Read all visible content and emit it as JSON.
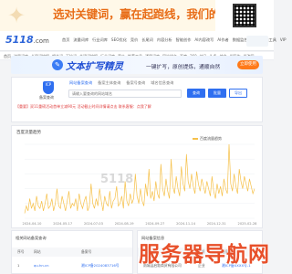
{
  "top_banner": {
    "headline": "选对关键词，赢在起跑线，我们的工具助你轻松实现!"
  },
  "header": {
    "logo": "5118",
    "logo_domain": ".com",
    "nav": [
      "首页",
      "流量词库",
      "行业词库",
      "SEO优化",
      "竞价",
      "长尾词",
      "内容分析",
      "智能创作",
      "AI内容改写",
      "AI作者",
      "数据监控",
      "API",
      "实用工具",
      "VIP"
    ]
  },
  "tool_nav": [
    "首页",
    "流量词库",
    "长尾词挖掘",
    "相关词",
    "下拉词",
    "关键词挖掘",
    "行业词库",
    "竞价",
    "推荐工具",
    "通用词库",
    "网站排名",
    "百度",
    "360",
    "神马",
    "头条",
    "综合",
    "AI写作",
    "AI改写"
  ],
  "promo": {
    "title": "文本扩写精灵",
    "subtitle": "一键扩写，原创提炼，通顺自然",
    "button": "立即使用"
  },
  "search": {
    "badge": "ICP",
    "caption": "备案查询",
    "tabs": [
      "网站备案查询",
      "备案主体查询",
      "备案号查询",
      "域名信息查询"
    ],
    "placeholder": "请输入要查询的网站域名",
    "btn_query": "查询",
    "btn_batch": "批量",
    "btn_export": "导出",
    "notice": "【重要】双11重磅活动首单立减90元 活动截止时间详情请点击 联系客服：点我了解"
  },
  "chart_data": {
    "type": "line",
    "title": "百度流量趋势",
    "series": [
      {
        "name": "百度流量趋势",
        "values": [
          2,
          5,
          3,
          8,
          4,
          6,
          3,
          9,
          5,
          4,
          7,
          3,
          6,
          10,
          4,
          5,
          8,
          3,
          6,
          12,
          5,
          4,
          9,
          6,
          3,
          7,
          11,
          4,
          6,
          5,
          8,
          3,
          10,
          6,
          4,
          7,
          9,
          3,
          5,
          14,
          6,
          4,
          8,
          5,
          12,
          7,
          3,
          9,
          6,
          5,
          11,
          4,
          7,
          8,
          13,
          5,
          6,
          9,
          4,
          15,
          7,
          5,
          10,
          6,
          8,
          18,
          9,
          6,
          12,
          7,
          5,
          14,
          9,
          20,
          8,
          11,
          7,
          15,
          10,
          8,
          22,
          12,
          9,
          16,
          11,
          8,
          24,
          13,
          10,
          17,
          12,
          9,
          21,
          14,
          11,
          26,
          15,
          12,
          18,
          13,
          10,
          19,
          14,
          11,
          16,
          13,
          10,
          15,
          12,
          9,
          17,
          11,
          8,
          14,
          10,
          13,
          9,
          16,
          12,
          10,
          30,
          14,
          11,
          18,
          13,
          10,
          20,
          15,
          12,
          17,
          14,
          11,
          16,
          13,
          10,
          12
        ]
      }
    ],
    "x_ticks": [
      "2024-04-10",
      "2024-05-17",
      "2024-07-03",
      "2024-08-19",
      "2024-09-27",
      "2024-11-14",
      "2024-12-31",
      "2025-02-28"
    ],
    "ylim": [
      0,
      30
    ],
    "grid": true,
    "legend_position": "top-right"
  },
  "left_card": {
    "title": "相关网站备案查询",
    "headers": [
      "序号",
      "网站",
      "备案号"
    ],
    "row": [
      "1",
      "qu.hn.cn",
      "湘ICP备2024083716号"
    ]
  },
  "right_card": {
    "title": "网站备案信息",
    "headers": [
      "主办单位",
      "性质",
      "备案号"
    ],
    "row": [
      "南城县启勃商贸有限公司",
      "企业",
      "湘ICP备XXXX号-1"
    ]
  },
  "watermark": "服务器导航网"
}
